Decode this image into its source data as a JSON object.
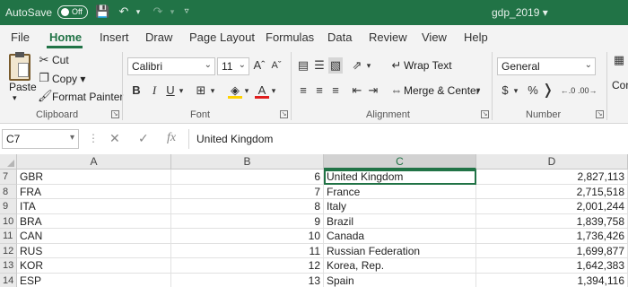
{
  "titlebar": {
    "autosave_label": "AutoSave",
    "autosave_state": "Off",
    "document_title": "gdp_2019",
    "accent_color": "#217346"
  },
  "tabs": [
    {
      "label": "File"
    },
    {
      "label": "Home"
    },
    {
      "label": "Insert"
    },
    {
      "label": "Draw"
    },
    {
      "label": "Page Layout"
    },
    {
      "label": "Formulas"
    },
    {
      "label": "Data"
    },
    {
      "label": "Review"
    },
    {
      "label": "View"
    },
    {
      "label": "Help"
    }
  ],
  "ribbon": {
    "clipboard": {
      "paste": "Paste",
      "cut": "Cut",
      "copy": "Copy",
      "format_painter": "Format Painter",
      "label": "Clipboard"
    },
    "font": {
      "font_name": "Calibri",
      "font_size": "11",
      "label": "Font"
    },
    "alignment": {
      "wrap_text": "Wrap Text",
      "merge_center": "Merge & Center",
      "label": "Alignment"
    },
    "number": {
      "format": "General",
      "label": "Number"
    },
    "cut_off_label": "Con"
  },
  "formula_bar": {
    "name_box": "C7",
    "fx": "fx",
    "content": "United Kingdom"
  },
  "grid": {
    "columns": [
      "A",
      "B",
      "C",
      "D"
    ],
    "selected_column": "C",
    "rows": [
      {
        "num": "7",
        "a": "GBR",
        "b": "6",
        "c": "United Kingdom",
        "d": "2,827,113"
      },
      {
        "num": "8",
        "a": "FRA",
        "b": "7",
        "c": "France",
        "d": "2,715,518"
      },
      {
        "num": "9",
        "a": "ITA",
        "b": "8",
        "c": "Italy",
        "d": "2,001,244"
      },
      {
        "num": "10",
        "a": "BRA",
        "b": "9",
        "c": "Brazil",
        "d": "1,839,758"
      },
      {
        "num": "11",
        "a": "CAN",
        "b": "10",
        "c": "Canada",
        "d": "1,736,426"
      },
      {
        "num": "12",
        "a": "RUS",
        "b": "11",
        "c": "Russian Federation",
        "d": "1,699,877"
      },
      {
        "num": "13",
        "a": "KOR",
        "b": "12",
        "c": "Korea, Rep.",
        "d": "1,642,383"
      },
      {
        "num": "14",
        "a": "ESP",
        "b": "13",
        "c": "Spain",
        "d": "1,394,116"
      }
    ]
  }
}
